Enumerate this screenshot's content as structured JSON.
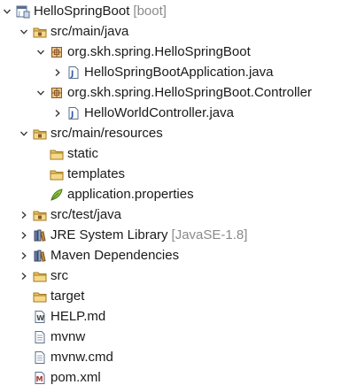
{
  "tree": [
    {
      "label": "HelloSpringBoot",
      "decoration": "[boot]",
      "icon": "project-icon",
      "arrow": "expanded",
      "depth": 0
    },
    {
      "label": "src/main/java",
      "decoration": "",
      "icon": "source-folder-icon",
      "arrow": "expanded",
      "depth": 1
    },
    {
      "label": "org.skh.spring.HelloSpringBoot",
      "decoration": "",
      "icon": "package-icon",
      "arrow": "expanded",
      "depth": 2
    },
    {
      "label": "HelloSpringBootApplication.java",
      "decoration": "",
      "icon": "java-file-icon",
      "arrow": "collapsed",
      "depth": 3
    },
    {
      "label": "org.skh.spring.HelloSpringBoot.Controller",
      "decoration": "",
      "icon": "package-icon",
      "arrow": "expanded",
      "depth": 2
    },
    {
      "label": "HelloWorldController.java",
      "decoration": "",
      "icon": "java-file-icon",
      "arrow": "collapsed",
      "depth": 3
    },
    {
      "label": "src/main/resources",
      "decoration": "",
      "icon": "source-folder-icon",
      "arrow": "expanded",
      "depth": 1
    },
    {
      "label": "static",
      "decoration": "",
      "icon": "folder-icon",
      "arrow": "none",
      "depth": 2
    },
    {
      "label": "templates",
      "decoration": "",
      "icon": "folder-icon",
      "arrow": "none",
      "depth": 2
    },
    {
      "label": "application.properties",
      "decoration": "",
      "icon": "properties-file-icon",
      "arrow": "none",
      "depth": 2
    },
    {
      "label": "src/test/java",
      "decoration": "",
      "icon": "source-folder-icon",
      "arrow": "collapsed",
      "depth": 1
    },
    {
      "label": "JRE System Library",
      "decoration": "[JavaSE-1.8]",
      "icon": "library-icon",
      "arrow": "collapsed",
      "depth": 1
    },
    {
      "label": "Maven Dependencies",
      "decoration": "",
      "icon": "library-icon",
      "arrow": "collapsed",
      "depth": 1
    },
    {
      "label": "src",
      "decoration": "",
      "icon": "folder-icon",
      "arrow": "collapsed",
      "depth": 1
    },
    {
      "label": "target",
      "decoration": "",
      "icon": "folder-icon",
      "arrow": "none",
      "depth": 1
    },
    {
      "label": "HELP.md",
      "decoration": "",
      "icon": "markdown-file-icon",
      "arrow": "none",
      "depth": 1
    },
    {
      "label": "mvnw",
      "decoration": "",
      "icon": "file-icon",
      "arrow": "none",
      "depth": 1
    },
    {
      "label": "mvnw.cmd",
      "decoration": "",
      "icon": "file-icon",
      "arrow": "none",
      "depth": 1
    },
    {
      "label": "pom.xml",
      "decoration": "",
      "icon": "maven-pom-icon",
      "arrow": "none",
      "depth": 1
    }
  ]
}
